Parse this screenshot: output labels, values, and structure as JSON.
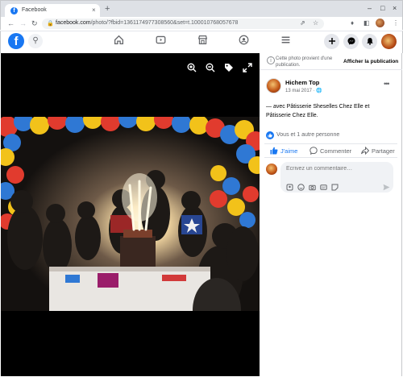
{
  "browser": {
    "tab_title": "Facebook",
    "tab_close": "×",
    "new_tab": "+",
    "url_host": "facebook.com",
    "url_path": "/photo/?fbid=1361174977308560&set=t.100010768057678",
    "window_controls": [
      "–",
      "□",
      "×"
    ],
    "icons": [
      "back-arrow-icon",
      "forward-arrow-icon",
      "reload-icon",
      "lock-icon",
      "share-icon",
      "star-icon",
      "extensions-icon",
      "sidepanel-icon",
      "kebab-menu-icon"
    ]
  },
  "facebook": {
    "logo": "f",
    "nav_icons": [
      "home-icon",
      "watch-icon",
      "marketplace-icon",
      "groups-icon",
      "menu-icon"
    ],
    "right_buttons": [
      "plus-icon",
      "messenger-icon",
      "bell-icon"
    ],
    "colors": {
      "brand": "#1877f2",
      "text": "#050505",
      "secondary": "#65676b"
    }
  },
  "viewer": {
    "tools": [
      "zoom-in-icon",
      "zoom-out-icon",
      "tag-icon",
      "fullscreen-icon"
    ]
  },
  "panel": {
    "notice_text": "Cette photo provient d'une publication.",
    "notice_link": "Afficher la publication",
    "author": "Hichem Top",
    "date": "13 mai 2017 ·",
    "caption": "— avec Pâtisserie Sheselles Chez Elle et Pâtisserie Chez Elle.",
    "reactions": "Vous et 1 autre personne",
    "actions": {
      "like": "J'aime",
      "comment": "Commenter",
      "share": "Partager"
    },
    "comment_placeholder": "Écrivez un commentaire…"
  }
}
